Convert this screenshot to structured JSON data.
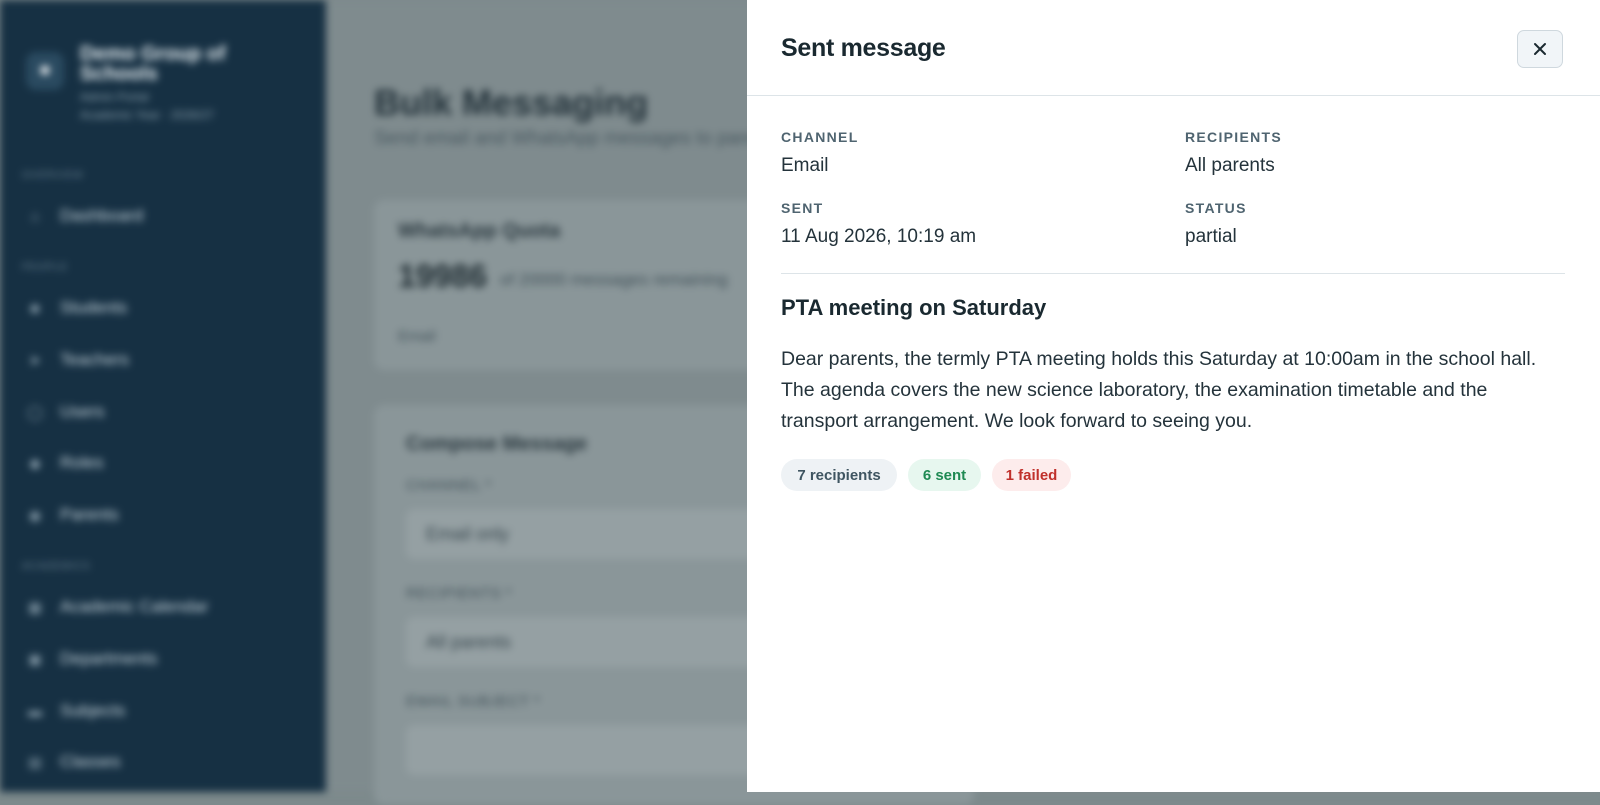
{
  "background": {
    "sidebar": {
      "brand_name": "Demo Group of Schools",
      "brand_sub": "Admin Portal",
      "brand_sub2": "Academic Year · 2026/27",
      "sections": [
        "OVERVIEW",
        "PEOPLE",
        "ACADEMICS"
      ],
      "items": [
        {
          "label": "Dashboard",
          "icon": "home-icon"
        },
        {
          "label": "Students",
          "icon": "user-icon"
        },
        {
          "label": "Teachers",
          "icon": "teacher-icon"
        },
        {
          "label": "Users",
          "icon": "users-icon"
        },
        {
          "label": "Roles",
          "icon": "shield-icon"
        },
        {
          "label": "Parents",
          "icon": "parent-icon"
        },
        {
          "label": "Academic Calendar",
          "icon": "calendar-icon"
        },
        {
          "label": "Departments",
          "icon": "building-icon"
        },
        {
          "label": "Subjects",
          "icon": "book-icon"
        },
        {
          "label": "Classes",
          "icon": "class-icon"
        }
      ]
    },
    "main": {
      "title": "Bulk Messaging",
      "subtitle": "Send email and WhatsApp messages to parents",
      "quota": {
        "title": "WhatsApp Quota",
        "number": "19986",
        "note": "of 20000 messages remaining",
        "email_label": "Email"
      },
      "compose": {
        "title": "Compose Message",
        "channel_label": "CHANNEL *",
        "channel_value": "Email only",
        "recipients_label": "RECIPIENTS *",
        "recipients_value": "All parents",
        "subject_label": "EMAIL SUBJECT *"
      }
    }
  },
  "drawer": {
    "title": "Sent message",
    "close_icon": "close-icon",
    "meta": {
      "channel_label": "CHANNEL",
      "channel_value": "Email",
      "recipients_label": "RECIPIENTS",
      "recipients_value": "All parents",
      "sent_label": "SENT",
      "sent_value": "11 Aug 2026, 10:19 am",
      "status_label": "STATUS",
      "status_value": "partial"
    },
    "subject": "PTA meeting on Saturday",
    "body": "Dear parents, the termly PTA meeting holds this Saturday at 10:00am in the school hall. The agenda covers the new science laboratory, the examination timetable and the transport arrangement. We look forward to seeing you.",
    "badges": {
      "recipients": "7 recipients",
      "sent": "6 sent",
      "failed": "1 failed"
    },
    "colors": {
      "sent": "#1f8a53",
      "failed": "#c0302b"
    }
  }
}
